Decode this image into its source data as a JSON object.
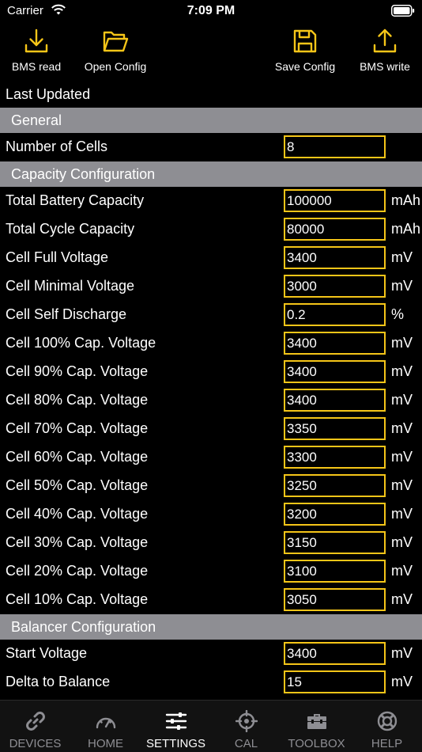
{
  "status": {
    "carrier": "Carrier",
    "time": "7:09 PM"
  },
  "toolbar": {
    "bms_read": "BMS read",
    "open_config": "Open Config",
    "save_config": "Save Config",
    "bms_write": "BMS write"
  },
  "last_updated": "Last Updated",
  "sections": {
    "general": "General",
    "capacity": "Capacity Configuration",
    "balancer": "Balancer Configuration"
  },
  "general": [
    {
      "label": "Number of Cells",
      "value": "8",
      "unit": ""
    }
  ],
  "capacity": [
    {
      "label": "Total Battery Capacity",
      "value": "100000",
      "unit": "mAh"
    },
    {
      "label": "Total Cycle Capacity",
      "value": "80000",
      "unit": "mAh"
    },
    {
      "label": "Cell Full Voltage",
      "value": "3400",
      "unit": "mV"
    },
    {
      "label": "Cell Minimal Voltage",
      "value": "3000",
      "unit": "mV"
    },
    {
      "label": "Cell Self Discharge",
      "value": "0.2",
      "unit": "%"
    },
    {
      "label": "Cell 100% Cap. Voltage",
      "value": "3400",
      "unit": "mV"
    },
    {
      "label": "Cell 90% Cap. Voltage",
      "value": "3400",
      "unit": "mV"
    },
    {
      "label": "Cell 80% Cap. Voltage",
      "value": "3400",
      "unit": "mV"
    },
    {
      "label": "Cell 70% Cap. Voltage",
      "value": "3350",
      "unit": "mV"
    },
    {
      "label": "Cell 60% Cap. Voltage",
      "value": "3300",
      "unit": "mV"
    },
    {
      "label": "Cell 50% Cap. Voltage",
      "value": "3250",
      "unit": "mV"
    },
    {
      "label": "Cell 40% Cap. Voltage",
      "value": "3200",
      "unit": "mV"
    },
    {
      "label": "Cell 30% Cap. Voltage",
      "value": "3150",
      "unit": "mV"
    },
    {
      "label": "Cell 20% Cap. Voltage",
      "value": "3100",
      "unit": "mV"
    },
    {
      "label": "Cell 10% Cap. Voltage",
      "value": "3050",
      "unit": "mV"
    }
  ],
  "balancer": [
    {
      "label": "Start Voltage",
      "value": "3400",
      "unit": "mV"
    },
    {
      "label": "Delta to Balance",
      "value": "15",
      "unit": "mV"
    }
  ],
  "tabs": {
    "devices": "DEVICES",
    "home": "HOME",
    "settings": "SETTINGS",
    "cal": "CAL",
    "toolbox": "TOOLBOX",
    "help": "HELP"
  },
  "colors": {
    "accent": "#f5c518",
    "section_bg": "#8e8e93",
    "tab_inactive": "#8e8e93"
  }
}
